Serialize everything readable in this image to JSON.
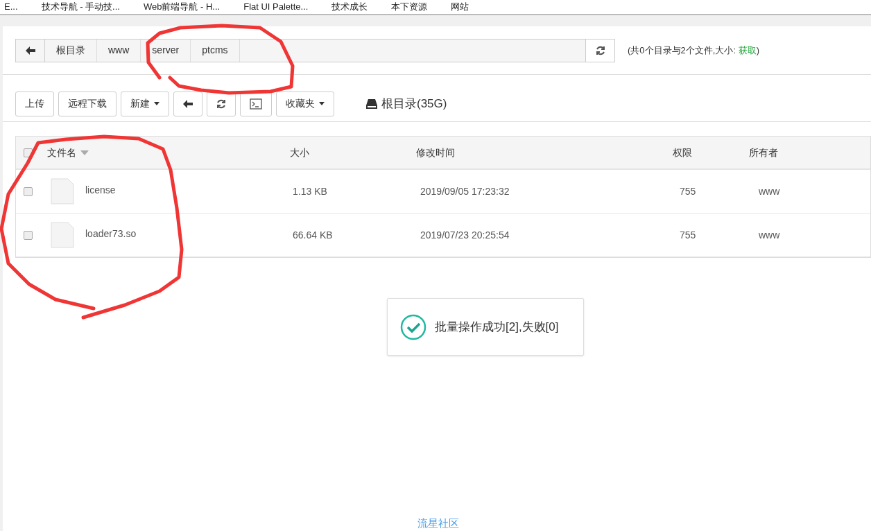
{
  "bookmarks": [
    {
      "label": "E..."
    },
    {
      "label": "技术导航 - 手动技..."
    },
    {
      "label": "Web前端导航 - H..."
    },
    {
      "label": "Flat UI Palette..."
    },
    {
      "label": "技术成长"
    },
    {
      "label": "本下资源"
    },
    {
      "label": "网站"
    }
  ],
  "breadcrumb": [
    "根目录",
    "www",
    "server",
    "ptcms"
  ],
  "summary": {
    "text": "(共0个目录与2个文件,大小: ",
    "link": "获取",
    "end": ")"
  },
  "toolbar": [
    {
      "kind": "text",
      "label": "上传"
    },
    {
      "kind": "text",
      "label": "远程下载"
    },
    {
      "kind": "dropdown",
      "label": "新建"
    },
    {
      "kind": "back"
    },
    {
      "kind": "refresh"
    },
    {
      "kind": "terminal"
    },
    {
      "kind": "dropdown",
      "label": "收藏夹"
    }
  ],
  "disk": "根目录(35G)",
  "table": {
    "columns": [
      "文件名",
      "大小",
      "修改时间",
      "权限",
      "所有者"
    ],
    "all_checked": false,
    "rows": [
      {
        "checked": false,
        "name": "license",
        "size": "1.13 KB",
        "modified": "2019/09/05 17:23:32",
        "perm": "755",
        "owner": "www"
      },
      {
        "checked": false,
        "name": "loader73.so",
        "size": "66.64 KB",
        "modified": "2019/07/23 20:25:54",
        "perm": "755",
        "owner": "www"
      }
    ]
  },
  "toast": {
    "message": "批量操作成功[2],失败[0]"
  },
  "footer": "流星社区"
}
